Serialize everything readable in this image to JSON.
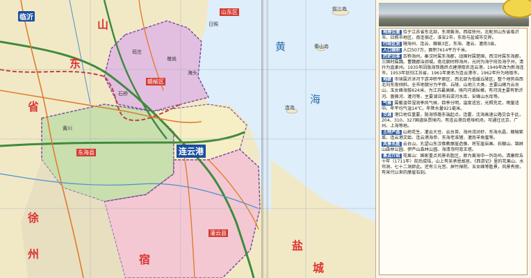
{
  "map": {
    "sea_name_1": "黄",
    "sea_name_2": "海",
    "main_city": "连云港",
    "cities": {
      "linyi": "临沂",
      "shandong_box": "山东区"
    },
    "province_chars": [
      "山",
      "东",
      "省",
      "徐",
      "州",
      "宿",
      "盐",
      "城"
    ],
    "districts": [
      "赣榆区",
      "东海县",
      "灌云县"
    ],
    "towns": [
      "日照",
      "班庄",
      "墩尚",
      "海头",
      "石桥",
      "黄川",
      "秦山岛",
      "连岛",
      "前三岛"
    ],
    "colors": {
      "sea": "#dfeefb",
      "mainland": "#f1e9c6",
      "region_ganyu": "#e2bfe0",
      "region_donghai": "#c9dfae",
      "region_south": "#f3c8d2",
      "road": "#e07b2f",
      "highway": "#3f8a3c",
      "border": "#7b4f9e"
    }
  },
  "panel": {
    "sections": [
      {
        "title": "地理位置",
        "text": "位于江苏省东北部，东濒黄海，西接徐州，北毗邻山东省临沂市、日照市地区，南连宿迁、淮安2市，东南与盐城市交界。"
      },
      {
        "title": "行政区划",
        "text": "辖海州、连云、赣榆3区，东海、灌云、灌南3县。"
      },
      {
        "title": "人口面积",
        "text": "人口507万，面积7614平方千米。"
      },
      {
        "title": "历史沿革",
        "text": "古称海州。秦汉时属东海郡，战国时属楚国，西汉时属东海郡，三国时属魏。曹魏郡治郯城。南北朝时称海州，元时为海宁府及海宁州，清升为直隶州。1935年因陇海铁路终点建港取名连云港，1949年改为新海连市，1953年划归江苏省，1961年更名为连云港市，1962年升为地级市。"
      },
      {
        "title": "地貌",
        "text": "市境属沂沭河下游冲积平原区，西北部为低缓丘陵区，整个地势自西北向东南倾斜。全市地貌分为平原、丘陵、山地三大类，主要山峰为云台山，玉女峰海拔624米，为江苏最高峰。境内河湖纵横，有河流主要有新沂河、蔷薇河、灌河等，主要湖泊有石梁河水库、安峰山水库等。"
      },
      {
        "title": "气候",
        "text": "属暖温带湿润季风气候，四季分明，温度适宜，光照充足，雨量适中。年平均气温14℃，年降水量921毫米。"
      },
      {
        "title": "交通",
        "text": "港口地位重要，陇海铁路东端起点，连霍、沈海高速公路交会于此，204、310、327国道纵贯境内，有连云港白塔埠机场，可通往北京、广州、上海等地。"
      },
      {
        "title": "土特产品",
        "text": "山地花生、灌云大豆、云台茶、海州湾对虾、东海水晶、赣榆紫菜、连云港文蛤、连云港海参、东海老淮猪、灌南羊角蜜等。"
      },
      {
        "title": "风景名胜",
        "text": "云台山，孔望山东汉佛教摩崖造像、将军崖岩画、石棚山、锦屏山森林公园、伊芦山森林公园、海清寺阿育王塔。"
      },
      {
        "title": "景点介绍",
        "text": "花果山：国家重点风景名胜区，原为黄海中一列岛屿，清康熙五十年（1711年）前后成陆，山上有吴承恩故居，《西游记》里的花果山、水帘洞、七十二洞即此。还有三元宫、屏竹禅院、玉女峰等胜景，风景秀丽，有宋代以来的摩崖石刻。"
      }
    ]
  }
}
